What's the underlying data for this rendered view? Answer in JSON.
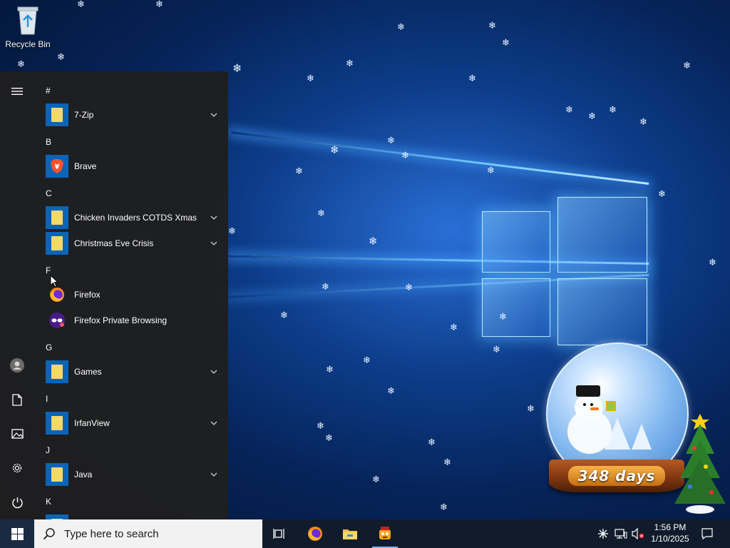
{
  "desktop": {
    "icons": [
      {
        "label": "Recycle Bin",
        "icon": "recycle-bin-icon"
      }
    ],
    "widget": {
      "days_label": "348 days"
    }
  },
  "start_menu": {
    "sections": [
      {
        "letter": "#",
        "apps": [
          {
            "name": "7-Zip",
            "icon": "folder-icon",
            "expandable": true
          }
        ]
      },
      {
        "letter": "B",
        "apps": [
          {
            "name": "Brave",
            "icon": "brave-icon",
            "expandable": false
          }
        ]
      },
      {
        "letter": "C",
        "apps": [
          {
            "name": "Chicken Invaders COTDS Xmas",
            "icon": "folder-icon",
            "expandable": true
          },
          {
            "name": "Christmas Eve Crisis",
            "icon": "folder-icon",
            "expandable": true
          }
        ]
      },
      {
        "letter": "F",
        "apps": [
          {
            "name": "Firefox",
            "icon": "firefox-icon",
            "expandable": false
          },
          {
            "name": "Firefox Private Browsing",
            "icon": "firefox-private-icon",
            "expandable": false
          }
        ]
      },
      {
        "letter": "G",
        "apps": [
          {
            "name": "Games",
            "icon": "folder-icon",
            "expandable": true
          }
        ]
      },
      {
        "letter": "I",
        "apps": [
          {
            "name": "IrfanView",
            "icon": "folder-icon",
            "expandable": true
          }
        ]
      },
      {
        "letter": "J",
        "apps": [
          {
            "name": "Java",
            "icon": "folder-icon",
            "expandable": true
          }
        ]
      },
      {
        "letter": "K",
        "apps": []
      }
    ],
    "rail": [
      "hamburger-menu-icon",
      "user-account-icon",
      "documents-icon",
      "pictures-icon",
      "settings-gear-icon",
      "power-icon"
    ]
  },
  "taskbar": {
    "search_placeholder": "Type here to search",
    "pinned": [
      "task-view-icon",
      "firefox-icon",
      "file-explorer-icon",
      "xmas-game-icon"
    ],
    "tray": [
      "network-activity-icon",
      "network-icon",
      "volume-muted-icon"
    ],
    "clock": {
      "time": "1:56 PM",
      "date": "1/10/2025"
    },
    "notifications_icon": "action-center-icon"
  },
  "colors": {
    "start_menu_bg": "#1f1f1f",
    "tile_blue": "#0a64b8",
    "taskbar_bg": "#101c2c",
    "search_bg": "#f2f2f2"
  }
}
